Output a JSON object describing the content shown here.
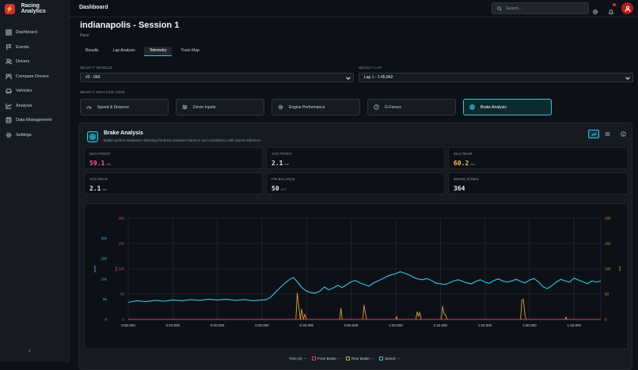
{
  "app": {
    "name": "Racing Analytics"
  },
  "topbar": {
    "title": "Dashboard",
    "search_placeholder": "Search..."
  },
  "sidebar": {
    "items": [
      {
        "label": "Dashboard",
        "icon": "grid-icon"
      },
      {
        "label": "Events",
        "icon": "flag-icon"
      },
      {
        "label": "Drivers",
        "icon": "users-icon"
      },
      {
        "label": "Compare Drivers",
        "icon": "users-compare-icon"
      },
      {
        "label": "Vehicles",
        "icon": "car-icon"
      },
      {
        "label": "Analysis",
        "icon": "chart-icon"
      },
      {
        "label": "Data Management",
        "icon": "database-icon"
      },
      {
        "label": "Settings",
        "icon": "gear-icon"
      }
    ],
    "collapse_label": "‹"
  },
  "page": {
    "title": "indianapolis - Session 1",
    "subtitle": "Race"
  },
  "tabs": [
    "Results",
    "Lap Analysis",
    "Telemetry",
    "Track Map"
  ],
  "active_tab": "Telemetry",
  "select_vehicle": {
    "label": "SELECT VEHICLE",
    "value": "#2 - 060"
  },
  "select_lap": {
    "label": "SELECT LAP",
    "value": "Lap 1 - 1:45.842"
  },
  "analysis_view": {
    "label": "SELECT ANALYSIS VIEW",
    "options": [
      "Speed & Distance",
      "Driver Inputs",
      "Engine Performance",
      "G-Forces",
      "Brake Analysis"
    ],
    "active": "Brake Analysis"
  },
  "panel": {
    "title": "Brake Analysis",
    "description": "Brake system evaluation showing front/rear pressure balance and consistency with speed reference"
  },
  "metrics": [
    {
      "label": "MAX FRONT",
      "value": "59.1",
      "unit": "bar",
      "color": "#ff5c8a"
    },
    {
      "label": "AVG FRONT",
      "value": "2.1",
      "unit": "bar",
      "color": "#e6edf3"
    },
    {
      "label": "MAX REAR",
      "value": "60.2",
      "unit": "bar",
      "color": "#f5c542"
    },
    {
      "label": "AVG REAR",
      "value": "2.1",
      "unit": "bar",
      "color": "#e6edf3"
    },
    {
      "label": "F/R BALANCE",
      "value": "50",
      "unit": "% F",
      "color": "#e6edf3"
    },
    {
      "label": "BRAKE ZONES",
      "value": "364",
      "unit": "",
      "color": "#e6edf3"
    }
  ],
  "legend": {
    "time": "Time (s):",
    "front": "Front Brake:",
    "rear": "Rear Brake:",
    "speed": "Speed:",
    "placeholder": "--"
  },
  "chart_data": {
    "type": "line",
    "x_label": "",
    "x_ticks": [
      "0:00.000",
      "0:10.000",
      "0:20.000",
      "0:30.000",
      "0:40.000",
      "0:50.000",
      "1:00.000",
      "1:10.000",
      "1:20.000",
      "1:30.000",
      "1:40.000"
    ],
    "xlim": [
      0,
      106
    ],
    "y_left_outer": {
      "label": "km/h",
      "ticks": [
        0,
        50,
        100,
        150,
        200
      ],
      "range": [
        0,
        250
      ]
    },
    "y_left_inner": {
      "label": "bar",
      "ticks": [
        0,
        50,
        100,
        150,
        200
      ],
      "range": [
        0,
        200
      ]
    },
    "y_right": {
      "label": "bar",
      "ticks": [
        0,
        50,
        100,
        150,
        200
      ],
      "range": [
        0,
        200
      ]
    },
    "grid": true,
    "colors": {
      "speed": "#39c5e0",
      "rear": "#e0a030",
      "front": "#d94070"
    },
    "series": [
      {
        "name": "Speed",
        "axis": "km/h",
        "x": [
          0,
          2,
          4,
          6,
          8,
          10,
          12,
          14,
          16,
          18,
          20,
          22,
          24,
          26,
          28,
          30,
          31,
          32,
          33,
          34,
          35,
          36,
          37,
          38,
          39,
          40,
          41,
          42,
          43,
          44,
          45,
          46,
          47,
          48,
          49,
          50,
          51,
          52,
          53,
          54,
          55,
          56,
          57,
          58,
          59,
          60,
          61,
          62,
          63,
          64,
          65,
          66,
          67,
          68,
          69,
          70,
          71,
          72,
          73,
          74,
          75,
          76,
          77,
          78,
          79,
          80,
          81,
          82,
          83,
          84,
          85,
          86,
          87,
          88,
          89,
          90,
          91,
          92,
          93,
          94,
          95,
          96,
          97,
          98,
          99,
          100,
          101,
          102,
          103,
          104,
          105,
          106
        ],
        "y": [
          42,
          46,
          44,
          47,
          45,
          48,
          46,
          49,
          47,
          50,
          48,
          50,
          47,
          49,
          46,
          48,
          49,
          55,
          67,
          78,
          88,
          97,
          104,
          92,
          78,
          70,
          66,
          65,
          70,
          80,
          73,
          78,
          84,
          79,
          86,
          93,
          96,
          90,
          86,
          82,
          90,
          95,
          100,
          106,
          110,
          113,
          118,
          114,
          110,
          104,
          100,
          98,
          101,
          96,
          90,
          88,
          86,
          90,
          95,
          98,
          94,
          90,
          88,
          94,
          98,
          92,
          89,
          96,
          100,
          95,
          92,
          95,
          99,
          94,
          90,
          97,
          101,
          93,
          81,
          76,
          83,
          92,
          99,
          95,
          92,
          102,
          97,
          93,
          88,
          95,
          92,
          95
        ]
      },
      {
        "name": "Rear Brake",
        "axis": "bar",
        "x": [
          0,
          37.6,
          37.9,
          38.2,
          38.6,
          38.9,
          39.3,
          39.6,
          40.0,
          47.4,
          47.7,
          48.0,
          52.6,
          52.9,
          53.2,
          53.5,
          60.0,
          60.2,
          60.4,
          64.5,
          64.8,
          65.1,
          65.4,
          65.7,
          70.2,
          70.5,
          70.8,
          71.2,
          71.5,
          88.0,
          88.3,
          88.6,
          89.0,
          89.3,
          98.0,
          98.2,
          98.4,
          106
        ],
        "y": [
          0,
          0,
          52,
          30,
          0,
          20,
          0,
          10,
          0,
          0,
          22,
          0,
          0,
          28,
          12,
          0,
          0,
          6,
          0,
          0,
          15,
          6,
          14,
          0,
          0,
          26,
          12,
          8,
          0,
          0,
          38,
          40,
          8,
          0,
          0,
          5,
          0,
          0
        ]
      },
      {
        "name": "Front Brake",
        "axis": "bar",
        "x": [
          0,
          106
        ],
        "y": [
          0,
          0
        ]
      }
    ]
  }
}
